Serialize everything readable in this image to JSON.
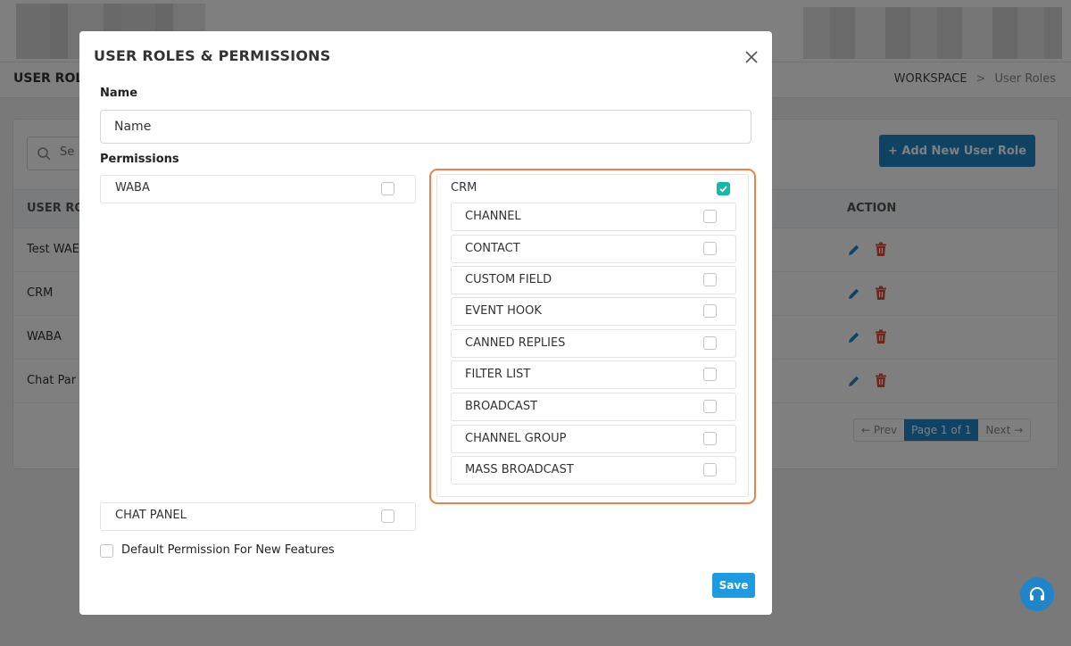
{
  "background": {
    "page_title": "USER ROLE",
    "breadcrumb": {
      "root": "WORKSPACE",
      "separator": ">",
      "current": "User Roles"
    },
    "search": {
      "placeholder": "Se"
    },
    "add_button": "+ Add New User Role",
    "table": {
      "columns": [
        "USER ROL",
        "ACTION"
      ],
      "rows": [
        {
          "name": "Test WAE"
        },
        {
          "name": "CRM"
        },
        {
          "name": "WABA"
        },
        {
          "name": "Chat Par"
        }
      ]
    },
    "pagination": {
      "prev": "← Prev",
      "current": "Page 1 of 1",
      "next": "Next →"
    }
  },
  "modal": {
    "title": "USER ROLES & PERMISSIONS",
    "name_label": "Name",
    "name_placeholder": "Name",
    "permissions_label": "Permissions",
    "groups": {
      "waba": {
        "label": "WABA",
        "checked": false
      },
      "chat_panel": {
        "label": "CHAT PANEL",
        "checked": false
      },
      "crm": {
        "label": "CRM",
        "checked": true,
        "items": [
          {
            "label": "CHANNEL",
            "checked": false
          },
          {
            "label": "CONTACT",
            "checked": false
          },
          {
            "label": "CUSTOM FIELD",
            "checked": false
          },
          {
            "label": "EVENT HOOK",
            "checked": false
          },
          {
            "label": "CANNED REPLIES",
            "checked": false
          },
          {
            "label": "FILTER LIST",
            "checked": false
          },
          {
            "label": "BROADCAST",
            "checked": false
          },
          {
            "label": "CHANNEL GROUP",
            "checked": false
          },
          {
            "label": "MASS BROADCAST",
            "checked": false
          }
        ]
      }
    },
    "default_permission_label": "Default Permission For New Features",
    "save_label": "Save"
  },
  "colors": {
    "primary": "#1e86c8",
    "checked": "#14b8a6",
    "highlight": "#f0804a",
    "delete": "#e04a3a"
  }
}
